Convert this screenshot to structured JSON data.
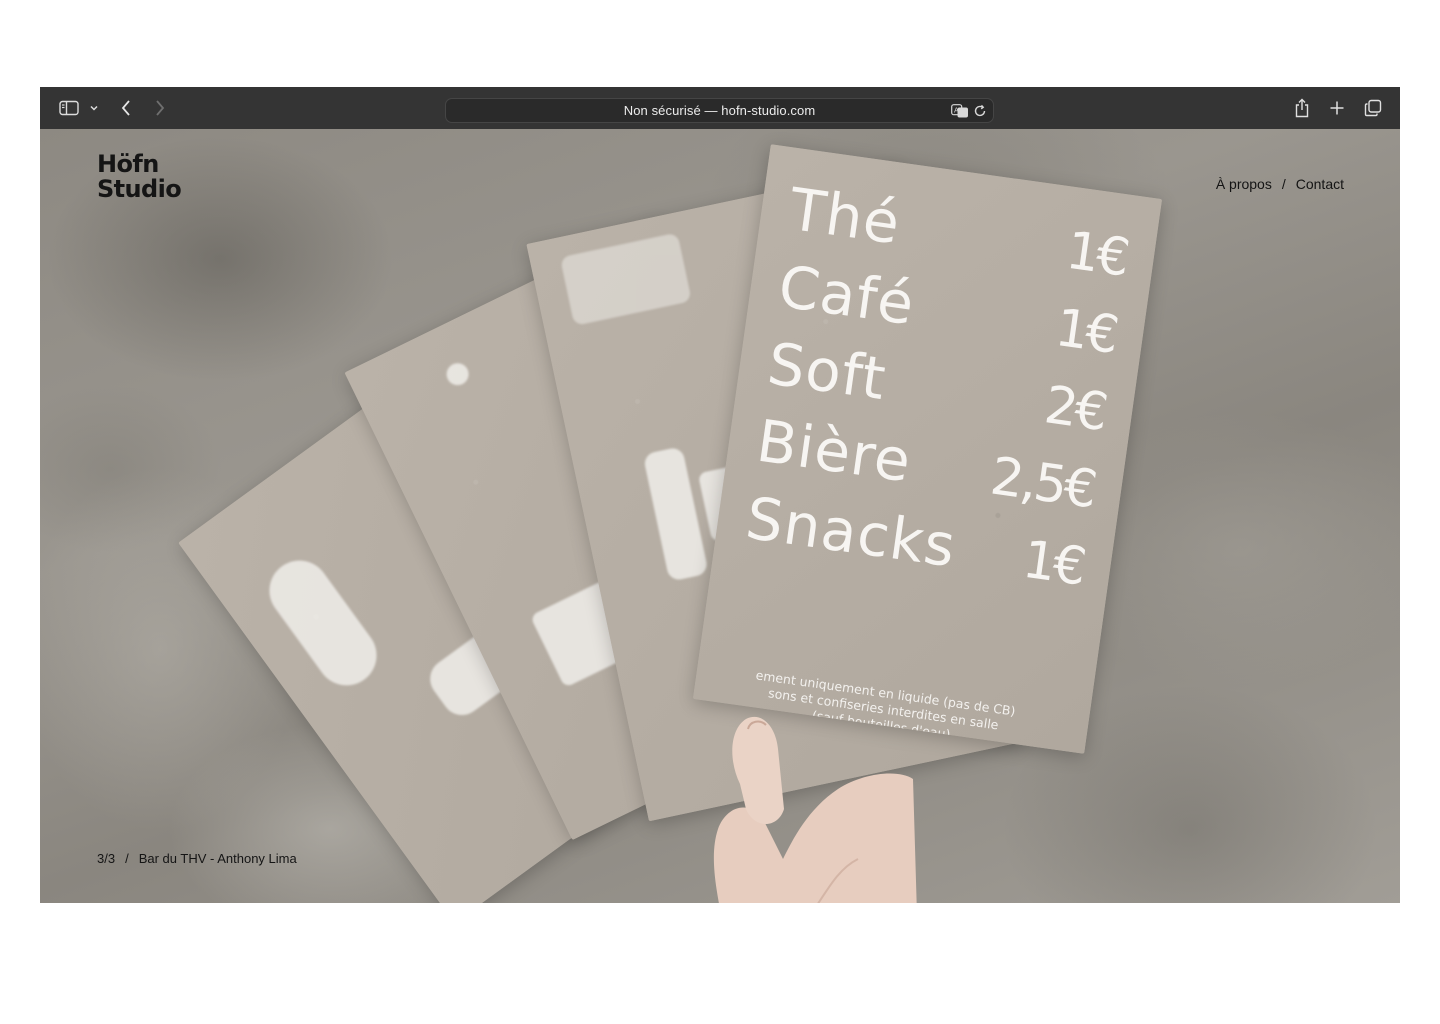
{
  "browser": {
    "address": "Non sécurisé — hofn-studio.com",
    "icons": [
      "sidebar-icon",
      "chevron-down-icon",
      "back-icon",
      "forward-icon",
      "translate-icon",
      "reload-icon",
      "share-icon",
      "new-tab-icon",
      "tabs-overview-icon"
    ]
  },
  "site": {
    "brand_line1": "Höfn",
    "brand_line2": "Studio",
    "nav": {
      "about": "À propos",
      "separator": "/",
      "contact": "Contact"
    },
    "caption": {
      "counter": "3/3",
      "separator": "/",
      "title": "Bar du THV - Anthony Lima"
    }
  },
  "photo": {
    "menu": [
      {
        "item": "Thé",
        "price": "1€"
      },
      {
        "item": "Café",
        "price": "1€"
      },
      {
        "item": "Soft",
        "price": "2€"
      },
      {
        "item": "Bière",
        "price": "2,5€"
      },
      {
        "item": "Snacks",
        "price": "1€"
      }
    ],
    "note_line1": "ement uniquement en liquide (pas de CB)",
    "note_line2": "sons et confiseries interdites en salle",
    "note_line3": "(sauf bouteilles d'eau)"
  },
  "colors": {
    "toolbar": "#343434",
    "address_bar": "#2a2a2a",
    "card": "#b6aea4",
    "print_white": "#f7f5f2",
    "text_dark": "#151515"
  }
}
